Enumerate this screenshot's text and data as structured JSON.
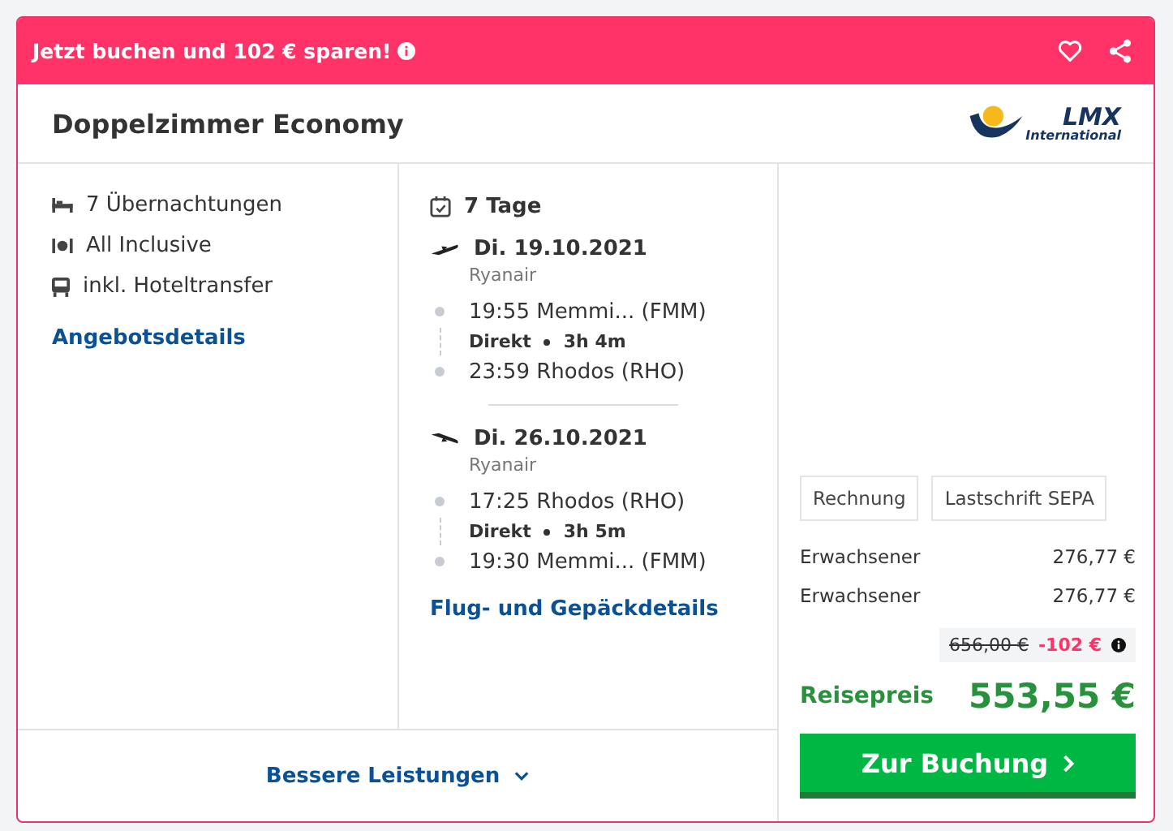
{
  "banner": {
    "text": "Jetzt buchen und 102 € sparen!"
  },
  "title": "Doppelzimmer Economy",
  "logo": {
    "name": "LMX",
    "sub": "International"
  },
  "features": [
    {
      "kind": "bed",
      "label": "7 Übernachtungen"
    },
    {
      "kind": "meal",
      "label": "All Inclusive"
    },
    {
      "kind": "bus",
      "label": "inkl. Hoteltransfer"
    }
  ],
  "offer_link": "Angebotsdetails",
  "duration": "7 Tage",
  "flights": [
    {
      "kind": "outbound",
      "date": "Di. 19.10.2021",
      "airline": "Ryanair",
      "depart": "19:55 Memmi... (FMM)",
      "direct": "Direkt",
      "time": "3h 4m",
      "arrive": "23:59 Rhodos (RHO)"
    },
    {
      "kind": "return",
      "date": "Di. 26.10.2021",
      "airline": "Ryanair",
      "depart": "17:25 Rhodos (RHO)",
      "direct": "Direkt",
      "time": "3h 5m",
      "arrive": "19:30 Memmi... (FMM)"
    }
  ],
  "flight_link": "Flug- und Gepäckdetails",
  "more_link": "Bessere Leistungen",
  "payments": [
    "Rechnung",
    "Lastschrift SEPA"
  ],
  "travellers": [
    {
      "label": "Erwachsener",
      "price": "276,77 €"
    },
    {
      "label": "Erwachsener",
      "price": "276,77 €"
    }
  ],
  "old_price": "656,00 €",
  "discount": "-102 €",
  "total_label": "Reisepreis",
  "total": "553,55 €",
  "book_button": "Zur Buchung"
}
